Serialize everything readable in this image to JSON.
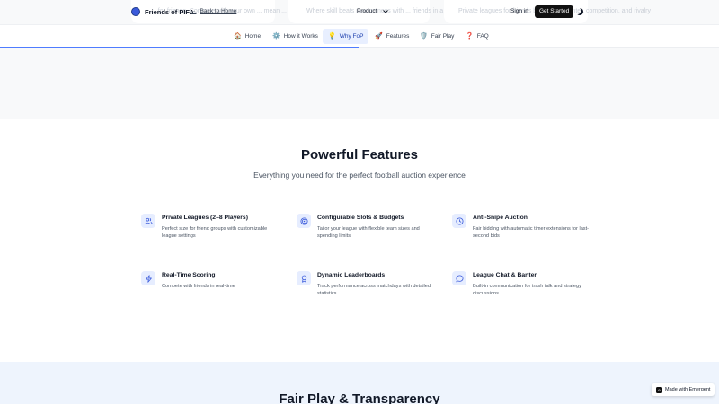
{
  "header": {
    "brand": "Friends of PIFA",
    "back_link": "Back to Home",
    "back_arrow": "←",
    "product_menu": "Product",
    "sign_in": "Sign in",
    "get_started": "Get Started"
  },
  "background_cards": [
    "... for friends. Compete with your own ... mean ... Your football knowledge and",
    "Where skill beats randomness with ... friends in a fair environment built for",
    "Private leagues for friends bring ... for banter, competition, and rivalry"
  ],
  "tabs": [
    {
      "label": "Home",
      "icon": "🏠"
    },
    {
      "label": "How it Works",
      "icon": "⚙️"
    },
    {
      "label": "Why FoP",
      "icon": "💡",
      "active": true
    },
    {
      "label": "Features",
      "icon": "🚀"
    },
    {
      "label": "Fair Play",
      "icon": "🛡️"
    },
    {
      "label": "FAQ",
      "icon": "❓"
    }
  ],
  "features": {
    "title": "Powerful Features",
    "subtitle": "Everything you need for the perfect football auction experience",
    "items": [
      {
        "title": "Private Leagues (2–8 Players)",
        "desc": "Perfect size for friend groups with customizable league settings",
        "icon": "users-icon"
      },
      {
        "title": "Configurable Slots & Budgets",
        "desc": "Tailor your league with flexible team sizes and spending limits",
        "icon": "target-icon"
      },
      {
        "title": "Anti-Snipe Auction",
        "desc": "Fair bidding with automatic timer extensions for last-second bids",
        "icon": "clock-icon"
      },
      {
        "title": "Real-Time Scoring",
        "desc": "Compete with friends in real-time",
        "icon": "lightning-icon"
      },
      {
        "title": "Dynamic Leaderboards",
        "desc": "Track performance across matchdays with detailed statistics",
        "icon": "medal-icon"
      },
      {
        "title": "League Chat & Banter",
        "desc": "Built-in communication for trash talk and strategy discussions",
        "icon": "chat-bubble-icon"
      }
    ]
  },
  "fair_play": {
    "title": "Fair Play & Transparency"
  },
  "badge": {
    "label": "Made with Emergent"
  },
  "colors": {
    "accent": "#4f7cff",
    "icon_bg": "#e6edff",
    "icon_stroke": "#3b5bdb",
    "band_bg": "#eef4fd"
  }
}
